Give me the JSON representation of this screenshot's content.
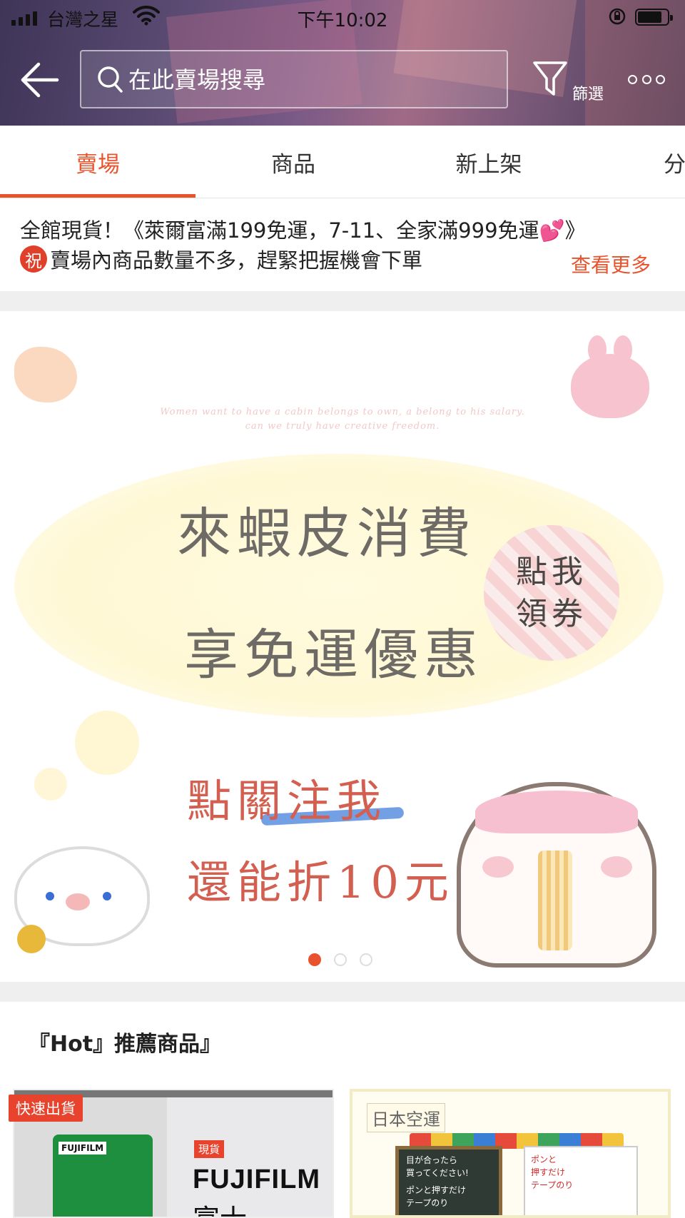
{
  "status_bar": {
    "carrier": "台灣之星",
    "time": "下午10:02"
  },
  "header": {
    "search_placeholder": "在此賣場搜尋",
    "filter_label": "篩選"
  },
  "tabs": [
    {
      "label": "賣場",
      "active": true
    },
    {
      "label": "商品",
      "active": false
    },
    {
      "label": "新上架",
      "active": false
    },
    {
      "label": "分",
      "active": false
    }
  ],
  "notice": {
    "line1": "全館現貨！《萊爾富滿199免運，7-11、全家滿999免運💕》",
    "line2_icon_text": "祝",
    "line2": "賣場內商品數量不多，趕緊把握機會下單",
    "see_more": "查看更多"
  },
  "banner": {
    "small_text_line1": "Women want to have a cabin belongs to own, a belong to his salary.",
    "small_text_line2": "can we truly have creative freedom.",
    "headline1": "來蝦皮消費",
    "headline2": "享免運優惠",
    "coupon_line1": "點我",
    "coupon_line2": "領券",
    "follow_line1": "點關注我",
    "follow_line2": "還能折10元",
    "slides_total": 3,
    "slide_active": 1
  },
  "recommended": {
    "title": "『Hot』推薦商品』",
    "products": [
      {
        "badge": "快速出貨",
        "box_label": "FUJIFILM",
        "spot_tag": "現貨",
        "brand": "FUJIFILM",
        "brand_sub": "富士"
      },
      {
        "origin_tag": "日本空運",
        "board_text1": "目が合ったら",
        "board_text2": "買ってください!",
        "board_text3": "ポンと押すだけ",
        "board_text4": "テープのり",
        "note_text1": "ポンと",
        "note_text2": "押すだけ",
        "note_text3": "テープのり"
      }
    ]
  }
}
